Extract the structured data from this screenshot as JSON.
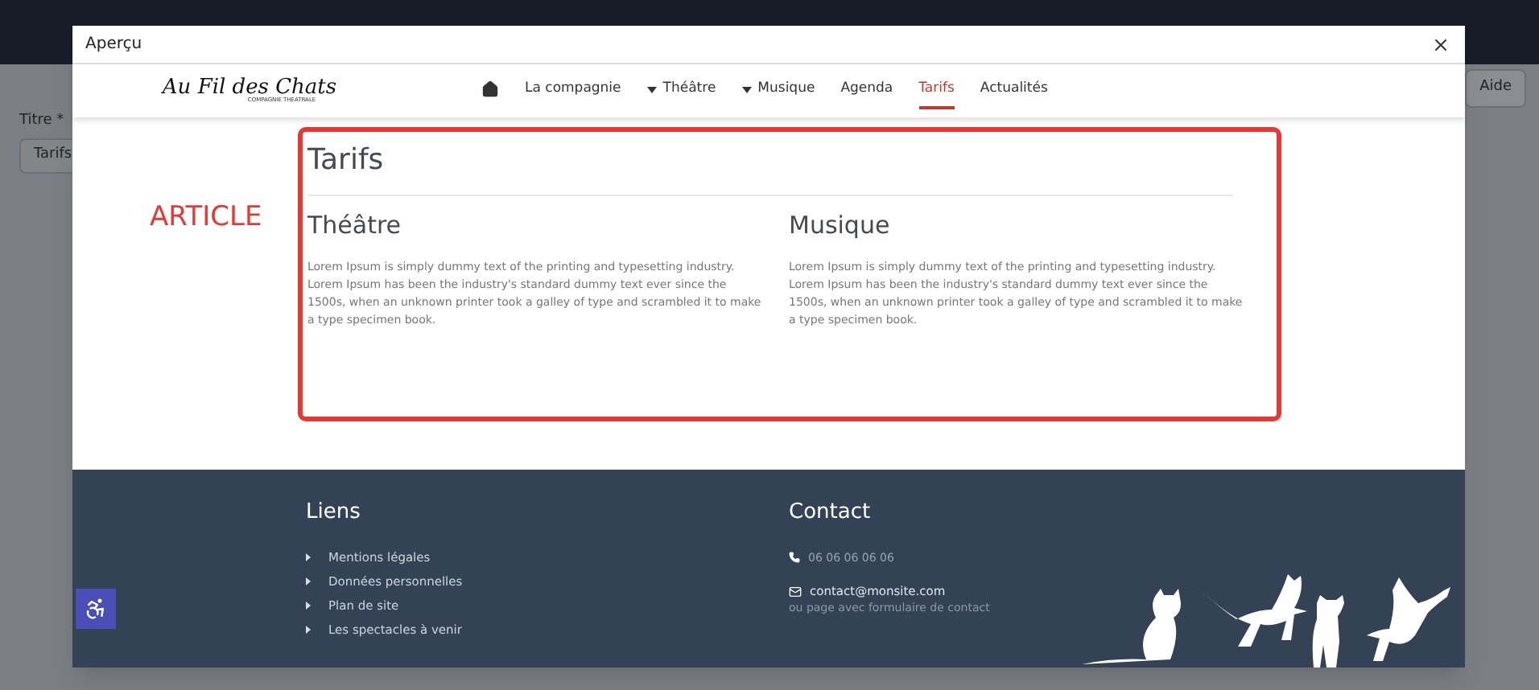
{
  "background": {
    "title_label": "Titre *",
    "title_value": "Tarifs",
    "help_button": "Aide"
  },
  "modal": {
    "title": "Aperçu"
  },
  "logo": {
    "name": "Au Fil des Chats",
    "tagline": "COMPAGNIE THEATRALE"
  },
  "nav": [
    {
      "kind": "home",
      "selected": false
    },
    {
      "kind": "link",
      "label": "La compagnie",
      "selected": false
    },
    {
      "kind": "dropdown",
      "label": "Théâtre",
      "selected": false
    },
    {
      "kind": "dropdown",
      "label": "Musique",
      "selected": false
    },
    {
      "kind": "link",
      "label": "Agenda",
      "selected": false
    },
    {
      "kind": "link",
      "label": "Tarifs",
      "selected": true
    },
    {
      "kind": "link",
      "label": "Actualités",
      "selected": false
    }
  ],
  "annotation": "ARTICLE",
  "article": {
    "title": "Tarifs",
    "columns": [
      {
        "heading": "Théâtre",
        "text": "Lorem Ipsum is simply dummy text of the printing and typesetting industry. Lorem Ipsum has been the industry's standard dummy text ever since the 1500s, when an unknown printer took a galley of type and scrambled it to make a type specimen book."
      },
      {
        "heading": "Musique",
        "text": "Lorem Ipsum is simply dummy text of the printing and typesetting industry. Lorem Ipsum has been the industry's standard dummy text ever since the 1500s, when an unknown printer took a galley of type and scrambled it to make a type specimen book."
      }
    ]
  },
  "footer": {
    "links_heading": "Liens",
    "links": [
      "Mentions légales",
      "Données personnelles",
      "Plan de site",
      "Les spectacles à venir"
    ],
    "contact_heading": "Contact",
    "phone": "06 06 06 06 06",
    "email": "contact@monsite.com",
    "email_note": "ou page avec formulaire de contact"
  }
}
